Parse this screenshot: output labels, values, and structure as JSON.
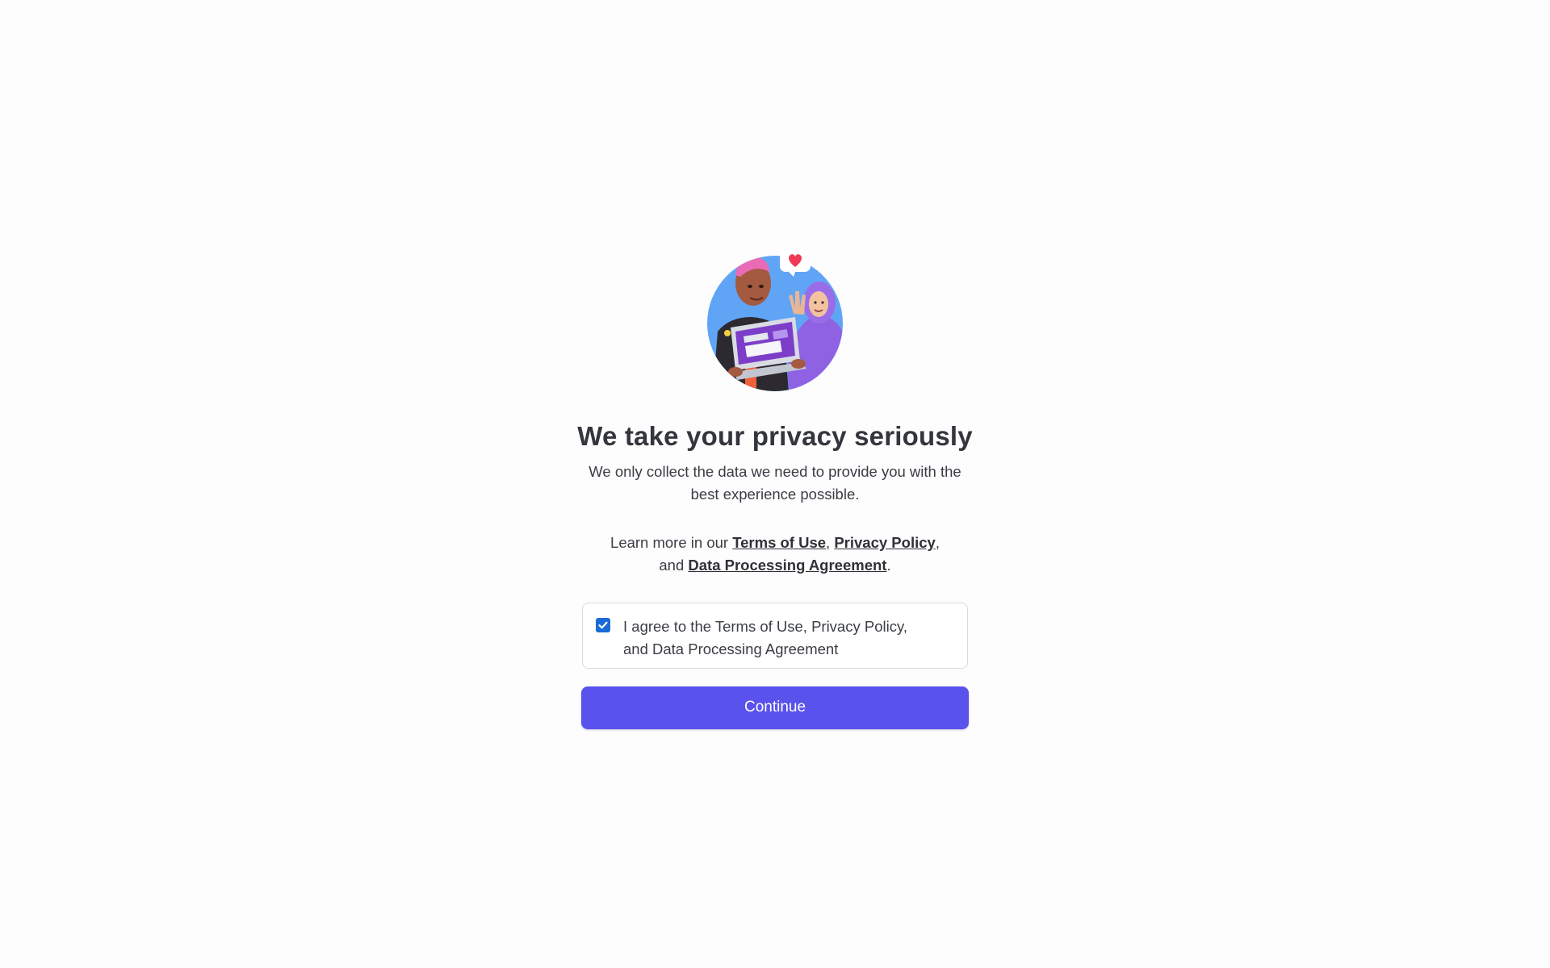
{
  "hero": {
    "illustration": "two-people-holding-laptop-illustration",
    "accent_color": "#60a5f5"
  },
  "title": "We take your privacy seriously",
  "subtitle": "We only collect the data we need to provide you with the best experience possible.",
  "learn_more": {
    "prefix": "Learn more in our ",
    "terms_link": "Terms of Use",
    "sep1": ", ",
    "privacy_link": "Privacy Policy",
    "sep2": ",",
    "and_text": "and ",
    "dpa_link": "Data Processing Agreement",
    "suffix": "."
  },
  "agreement": {
    "checked": true,
    "label": "I agree to the Terms of Use, Privacy Policy, and Data Processing Agreement"
  },
  "continue_button": {
    "label": "Continue",
    "color": "#5a52ec"
  }
}
